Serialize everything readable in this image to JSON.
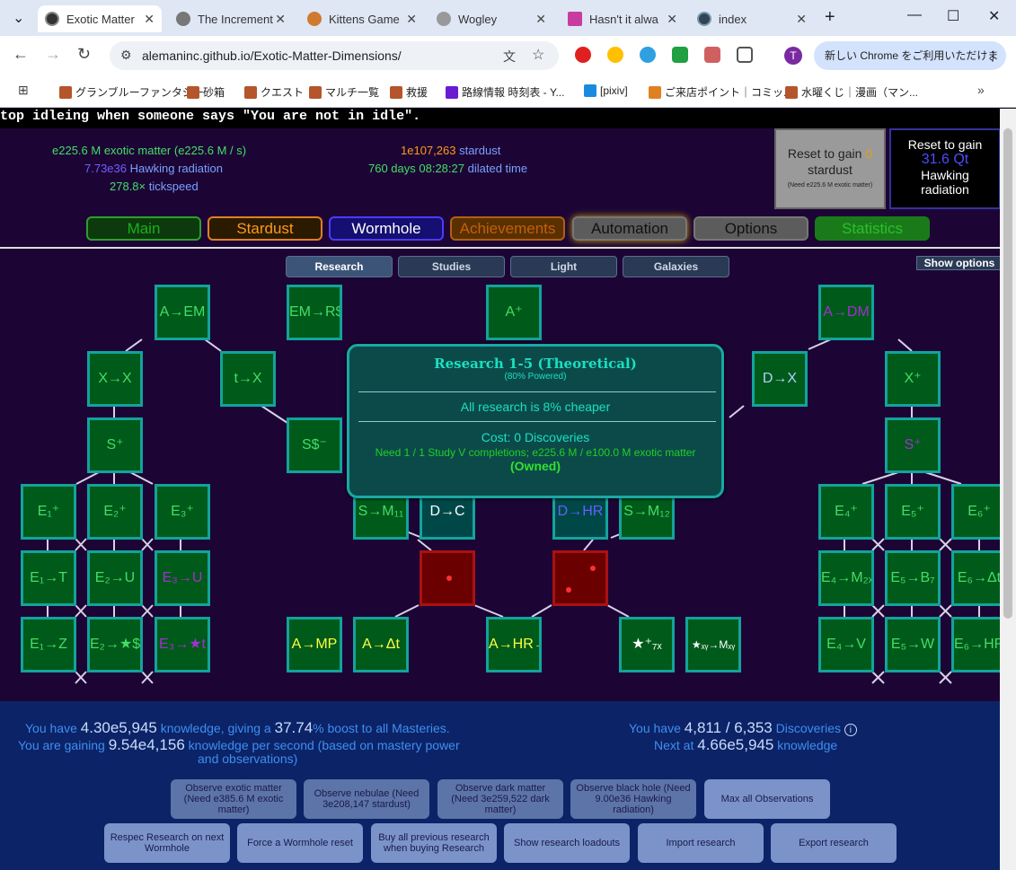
{
  "browser": {
    "tabs": [
      {
        "title": "Exotic Matter",
        "active": true
      },
      {
        "title": "The Increment"
      },
      {
        "title": "Kittens Game"
      },
      {
        "title": "Wogley"
      },
      {
        "title": "Hasn't it alwa"
      },
      {
        "title": "index"
      }
    ],
    "url": "alemaninc.github.io/Exotic-Matter-Dimensions/",
    "update_text": "新しい Chrome をご利用いただけます",
    "profile_initial": "T",
    "bookmarks": [
      "グランブルーファンタジー",
      "砂箱",
      "クエスト",
      "マルチ一覧",
      "救援",
      "路線情報 時刻表 - Y...",
      "[pixiv]",
      "ご来店ポイント｜コミッ...",
      "水曜くじ｜漫画（マン..."
    ]
  },
  "news": "top idleing when someone says  \"You are not in idle\".",
  "stats": {
    "em_value": "e225.6 M",
    "em_label": "exotic matter",
    "em_rate": "(e225.6 M / s)",
    "hr_value": "7.73e36",
    "hr_label": "Hawking radiation",
    "ts_value": "278.8×",
    "ts_label": "tickspeed",
    "stardust_value": "1e107,263",
    "stardust_label": "stardust",
    "dilated_value": "760 days 08:28:27",
    "dilated_label": "dilated time"
  },
  "reset_stardust": {
    "line1": "Reset to gain",
    "amount": "0",
    "line2": "stardust",
    "need": "(Need e225.6 M exotic matter)"
  },
  "reset_hawking": {
    "line1": "Reset to gain",
    "amount": "31.6 Qt",
    "line2": "Hawking",
    "line3": "radiation"
  },
  "main_tabs": [
    "Main",
    "Stardust",
    "Wormhole",
    "Achievements",
    "Automation",
    "Options",
    "Statistics"
  ],
  "sub_tabs": [
    "Research",
    "Studies",
    "Light",
    "Galaxies"
  ],
  "show_options": "Show options",
  "tooltip": {
    "title": "Research 1-5 (Theoretical)",
    "powered": "(80% Powered)",
    "effect": "All research is 8% cheaper",
    "cost": "Cost: 0 Discoveries",
    "need": "Need 1 / 1 Study V completions; e225.6 M / e100.0 M exotic matter",
    "status": "(Owned)"
  },
  "research_nodes": [
    {
      "id": "A→EM",
      "c": "#44dd66"
    },
    {
      "id": "EM→R$",
      "c": "#44dd66"
    },
    {
      "id": "A⁺",
      "c": "#44dd66"
    },
    {
      "id": "A→DM",
      "c": "#a030d0"
    },
    {
      "id": "X→X",
      "c": "#44dd66"
    },
    {
      "id": "t→X",
      "c": "#44dd66"
    },
    {
      "id": "D→X",
      "c": "#b0d0ff"
    },
    {
      "id": "X⁺",
      "c": "#44dd66"
    },
    {
      "id": "S⁺",
      "c": "#44dd66"
    },
    {
      "id": "S$⁻",
      "c": "#44dd66"
    },
    {
      "id": "S⁺",
      "c": "#a030d0"
    },
    {
      "id": "E₁⁺",
      "c": "#44dd66"
    },
    {
      "id": "E₂⁺",
      "c": "#44dd66"
    },
    {
      "id": "E₃⁺",
      "c": "#44dd66"
    },
    {
      "id": "S→M₁₁",
      "c": "#44dd66"
    },
    {
      "id": "D→C",
      "c": "#ffffff"
    },
    {
      "id": "D→HR",
      "c": "#6060ff"
    },
    {
      "id": "S→M₁₂",
      "c": "#44dd66"
    },
    {
      "id": "E₄⁺",
      "c": "#44dd66"
    },
    {
      "id": "E₅⁺",
      "c": "#44dd66"
    },
    {
      "id": "E₆⁺",
      "c": "#44dd66"
    },
    {
      "id": "E₁→T",
      "c": "#44dd66"
    },
    {
      "id": "E₂→U",
      "c": "#44dd66"
    },
    {
      "id": "E₃→U",
      "c": "#a030d0"
    },
    {
      "id": "E₄→M₂ₓ",
      "c": "#44dd66"
    },
    {
      "id": "E₅→B₇",
      "c": "#44dd66"
    },
    {
      "id": "E₆→Δt",
      "c": "#44dd66"
    },
    {
      "id": "E₁→Z",
      "c": "#44dd66"
    },
    {
      "id": "E₂→★$",
      "c": "#44dd66"
    },
    {
      "id": "E₃→★t",
      "c": "#a030d0"
    },
    {
      "id": "A→MP",
      "c": "#ffff40"
    },
    {
      "id": "A→Δt",
      "c": "#ffff40"
    },
    {
      "id": "A→HR→★",
      "c": "#ffff40"
    },
    {
      "id": "★⁺₇ₓ",
      "c": "#ffffff"
    },
    {
      "id": "★ₓᵧ→Mₓᵧ",
      "c": "#ffffff"
    },
    {
      "id": "E₄→V",
      "c": "#44dd66"
    },
    {
      "id": "E₅→W",
      "c": "#44dd66"
    },
    {
      "id": "E₆→HR",
      "c": "#44dd66"
    }
  ],
  "knowledge": {
    "you_have": "You have",
    "amount": "4.30e5,945",
    "giving": "knowledge, giving a",
    "boost": "37.74",
    "boost_suffix": "% boost to all Masteries.",
    "gaining": "You are gaining",
    "rate": "9.54e4,156",
    "rate_suffix": "knowledge per second (based on mastery power",
    "rate_suffix2": "and observations)"
  },
  "discoveries": {
    "you_have": "You have",
    "amount": "4,811 / 6,353",
    "label": "Discoveries",
    "next_at": "Next at",
    "next_amount": "4.66e5,945",
    "next_label": "knowledge",
    "info": "i"
  },
  "buttons_row1": [
    "Observe exotic matter (Need e385.6 M exotic matter)",
    "Observe nebulae (Need 3e208,147 stardust)",
    "Observe dark matter (Need 3e259,522 dark matter)",
    "Observe black hole (Need 9.00e36 Hawking radiation)",
    "Max all Observations"
  ],
  "buttons_row2": [
    "Respec Research on next Wormhole",
    "Force a Wormhole reset",
    "Buy all previous research when buying Research",
    "Show research loadouts",
    "Import research",
    "Export research"
  ],
  "colors": {
    "accent": "#13a39c",
    "background": "#1c0535",
    "panel": "#0a286e"
  }
}
